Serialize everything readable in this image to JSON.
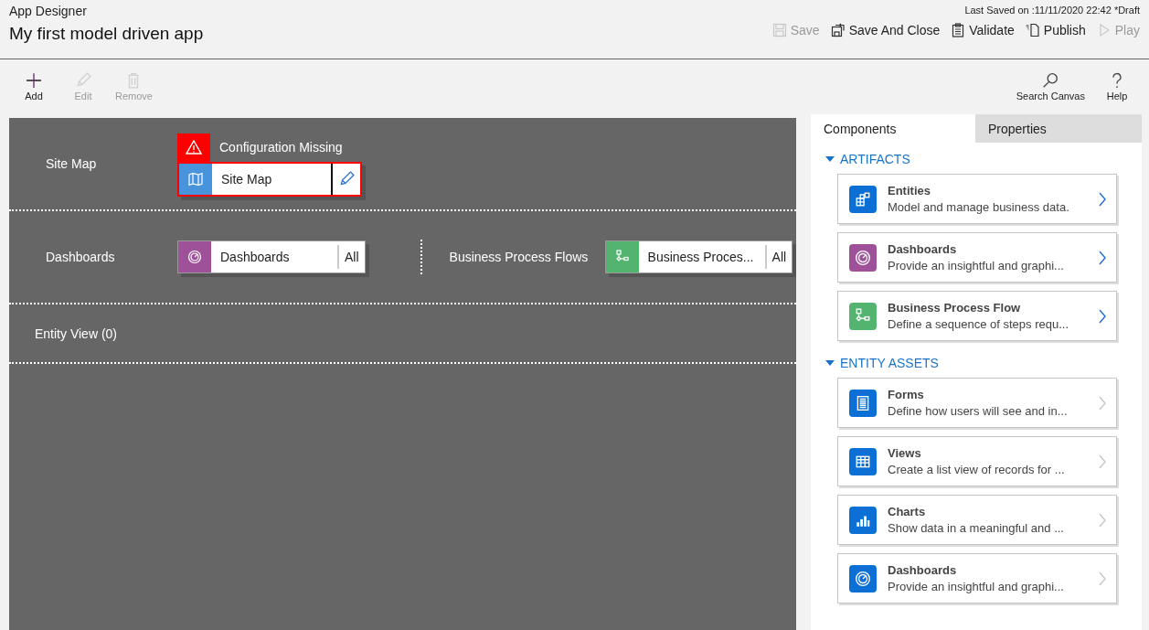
{
  "header": {
    "app": "App Designer",
    "title": "My first model driven app",
    "last_saved": "Last Saved on :11/11/2020 22:42 *Draft",
    "actions": [
      {
        "kind": "save",
        "label": "Save",
        "disabled": true
      },
      {
        "kind": "saveclose",
        "label": "Save And Close",
        "disabled": false
      },
      {
        "kind": "validate",
        "label": "Validate",
        "disabled": false
      },
      {
        "kind": "publish",
        "label": "Publish",
        "disabled": false
      },
      {
        "kind": "play",
        "label": "Play",
        "disabled": true
      }
    ]
  },
  "toolbar": {
    "left": [
      {
        "kind": "add",
        "label": "Add",
        "disabled": false
      },
      {
        "kind": "edit",
        "label": "Edit",
        "disabled": true
      },
      {
        "kind": "remove",
        "label": "Remove",
        "disabled": true
      }
    ],
    "right": [
      {
        "kind": "search",
        "label": "Search Canvas",
        "disabled": false
      },
      {
        "kind": "help",
        "label": "Help",
        "disabled": false
      }
    ]
  },
  "canvas": {
    "site_map": {
      "label": "Site Map",
      "warning": "Configuration Missing",
      "tile": {
        "kind": "map",
        "label": "Site Map",
        "color": "#4793dc"
      }
    },
    "groups": [
      {
        "label": "Dashboards",
        "tile": {
          "kind": "gauge",
          "label": "Dashboards",
          "badge": "All",
          "color": "#9e5198"
        }
      },
      {
        "label": "Business Process Flows",
        "tile": {
          "kind": "flow",
          "label": "Business Proces...",
          "badge": "All",
          "color": "#52b46e"
        }
      }
    ],
    "entity_view": {
      "label": "Entity View (0)"
    }
  },
  "panel": {
    "tabs": [
      {
        "label": "Components",
        "selected": true
      },
      {
        "label": "Properties",
        "selected": false
      }
    ],
    "sections": [
      {
        "title": "ARTIFACTS",
        "expanded": true,
        "items": [
          {
            "kind": "entities",
            "title": "Entities",
            "description": "Model and manage business data.",
            "color": "#0b6fd6",
            "disabled": false
          },
          {
            "kind": "gauge",
            "title": "Dashboards",
            "description": "Provide an insightful and graphi...",
            "color": "#9e5198",
            "disabled": false
          },
          {
            "kind": "flow",
            "title": "Business Process Flow",
            "description": "Define a sequence of steps requ...",
            "color": "#52b46e",
            "disabled": false
          }
        ]
      },
      {
        "title": "ENTITY ASSETS",
        "expanded": true,
        "items": [
          {
            "kind": "form",
            "title": "Forms",
            "description": "Define how users will see and in...",
            "color": "#0b6fd6",
            "disabled": true
          },
          {
            "kind": "grid",
            "title": "Views",
            "description": "Create a list view of records for ...",
            "color": "#0b6fd6",
            "disabled": true
          },
          {
            "kind": "chart",
            "title": "Charts",
            "description": "Show data in a meaningful and ...",
            "color": "#0b6fd6",
            "disabled": true
          },
          {
            "kind": "gauge",
            "title": "Dashboards",
            "description": "Provide an insightful and graphi...",
            "color": "#0b6fd6",
            "disabled": true
          }
        ]
      }
    ]
  }
}
